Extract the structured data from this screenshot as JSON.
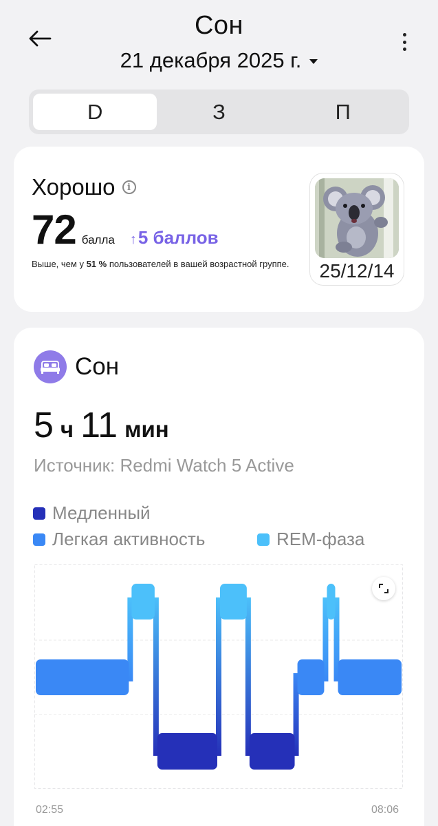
{
  "header": {
    "title": "Сон",
    "date": "21 декабря 2025 г."
  },
  "tabs": [
    {
      "label": "D",
      "active": true
    },
    {
      "label": "З",
      "active": false
    },
    {
      "label": "П",
      "active": false
    }
  ],
  "score": {
    "label": "Хорошо",
    "value": "72",
    "unit": "балла",
    "delta": "5 баллов",
    "desc_prefix": "Выше, чем у ",
    "desc_percent": "51 %",
    "desc_suffix": " пользователей в вашей возрастной группе.",
    "badge_date": "25/12/14"
  },
  "sleep": {
    "title": "Сон",
    "hours": "5",
    "hours_unit": "ч",
    "minutes": "11",
    "minutes_unit": "мин",
    "source": "Источник: Redmi Watch 5 Active"
  },
  "legend": [
    {
      "label": "Медленный",
      "color": "#2530b8"
    },
    {
      "label": "Легкая активность",
      "color": "#3a88f5"
    },
    {
      "label": "REM-фаза",
      "color": "#4cc0fa"
    }
  ],
  "chart_data": {
    "type": "hypnogram",
    "start_time": "02:55",
    "end_time": "08:06",
    "stage_levels": [
      "Медленный",
      "Легкая активность",
      "REM-фаза"
    ],
    "segments": [
      {
        "stage": "Легкая активность",
        "span": [
          0.0,
          0.26
        ]
      },
      {
        "stage": "REM-фаза",
        "span": [
          0.26,
          0.33
        ]
      },
      {
        "stage": "Медленный",
        "span": [
          0.33,
          0.5
        ]
      },
      {
        "stage": "REM-фаза",
        "span": [
          0.5,
          0.58
        ]
      },
      {
        "stage": "Медленный",
        "span": [
          0.58,
          0.71
        ]
      },
      {
        "stage": "Легкая активность",
        "span": [
          0.71,
          0.79
        ]
      },
      {
        "stage": "REM-фаза",
        "span": [
          0.79,
          0.82
        ]
      },
      {
        "stage": "Легкая активность",
        "span": [
          0.82,
          1.0
        ]
      }
    ]
  }
}
